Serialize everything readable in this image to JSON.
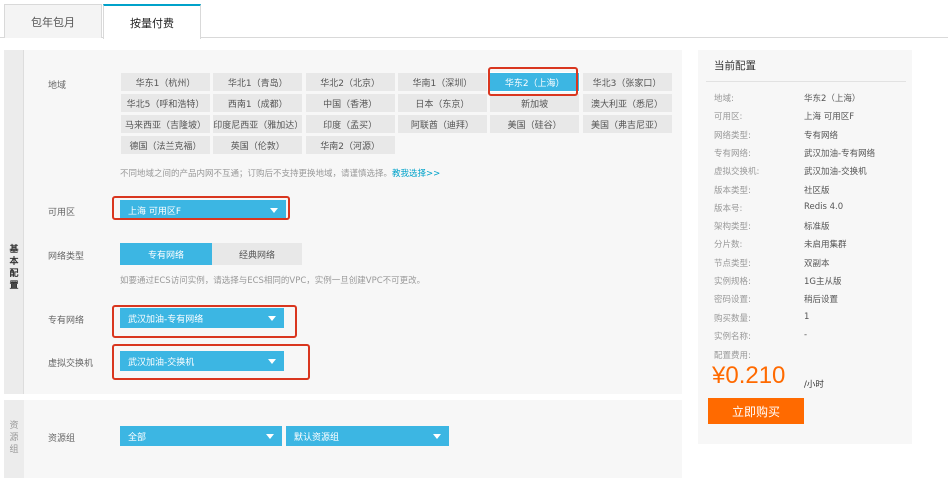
{
  "tabs": [
    {
      "label": "包年包月"
    },
    {
      "label": "按量付费"
    }
  ],
  "sidebar": {
    "basic_config": "基本配置",
    "resource_group": "资源组"
  },
  "region": {
    "label": "地域",
    "items": [
      "华东1（杭州）",
      "华北1（青岛）",
      "华北2（北京）",
      "华南1（深圳）",
      "华东2（上海）",
      "华北3（张家口）",
      "华北5（呼和浩特）",
      "西南1（成都）",
      "中国（香港）",
      "日本（东京）",
      "新加坡",
      "澳大利亚（悉尼）",
      "马来西亚（吉隆坡）",
      "印度尼西亚（雅加达）",
      "印度（孟买）",
      "阿联酋（迪拜）",
      "美国（硅谷）",
      "美国（弗吉尼亚）",
      "德国（法兰克福）",
      "英国（伦敦）",
      "华南2（河源）"
    ],
    "selected": "华东2（上海）",
    "hint": "不同地域之间的产品内网不互通；订购后不支持更换地域，请谨慎选择。",
    "hint_link": "教我选择>>"
  },
  "zone": {
    "label": "可用区",
    "value": "上海 可用区F"
  },
  "network": {
    "label": "网络类型",
    "options": [
      "专有网络",
      "经典网络"
    ],
    "selected": "专有网络",
    "hint": "如要通过ECS访问实例，请选择与ECS相同的VPC，实例一旦创建VPC不可更改。"
  },
  "vpc": {
    "label": "专有网络",
    "value": "武汉加油-专有网络"
  },
  "vswitch": {
    "label": "虚拟交换机",
    "value": "武汉加油-交换机"
  },
  "resource_group": {
    "label": "资源组",
    "select1": "全部",
    "select2": "默认资源组"
  },
  "config": {
    "title": "当前配置",
    "rows": [
      {
        "label": "地域:",
        "value": "华东2（上海）"
      },
      {
        "label": "可用区:",
        "value": "上海 可用区F"
      },
      {
        "label": "网络类型:",
        "value": "专有网络"
      },
      {
        "label": "专有网络:",
        "value": "武汉加油-专有网络"
      },
      {
        "label": "虚拟交换机:",
        "value": "武汉加油-交换机"
      },
      {
        "label": "版本类型:",
        "value": "社区版"
      },
      {
        "label": "版本号:",
        "value": "Redis 4.0"
      },
      {
        "label": "架构类型:",
        "value": "标准版"
      },
      {
        "label": "分片数:",
        "value": "未启用集群"
      },
      {
        "label": "节点类型:",
        "value": "双副本"
      },
      {
        "label": "实例规格:",
        "value": "1G主从版"
      },
      {
        "label": "密码设置:",
        "value": "稍后设置"
      },
      {
        "label": "购买数量:",
        "value": "1"
      },
      {
        "label": "实例名称:",
        "value": "-"
      }
    ],
    "fee_label": "配置费用:",
    "price": "¥0.210",
    "price_unit": "/小时",
    "buy_label": "立即购买"
  },
  "colors": {
    "accent": "#3cb6e3",
    "orange": "#ff6a00",
    "highlight": "#d9361f"
  }
}
